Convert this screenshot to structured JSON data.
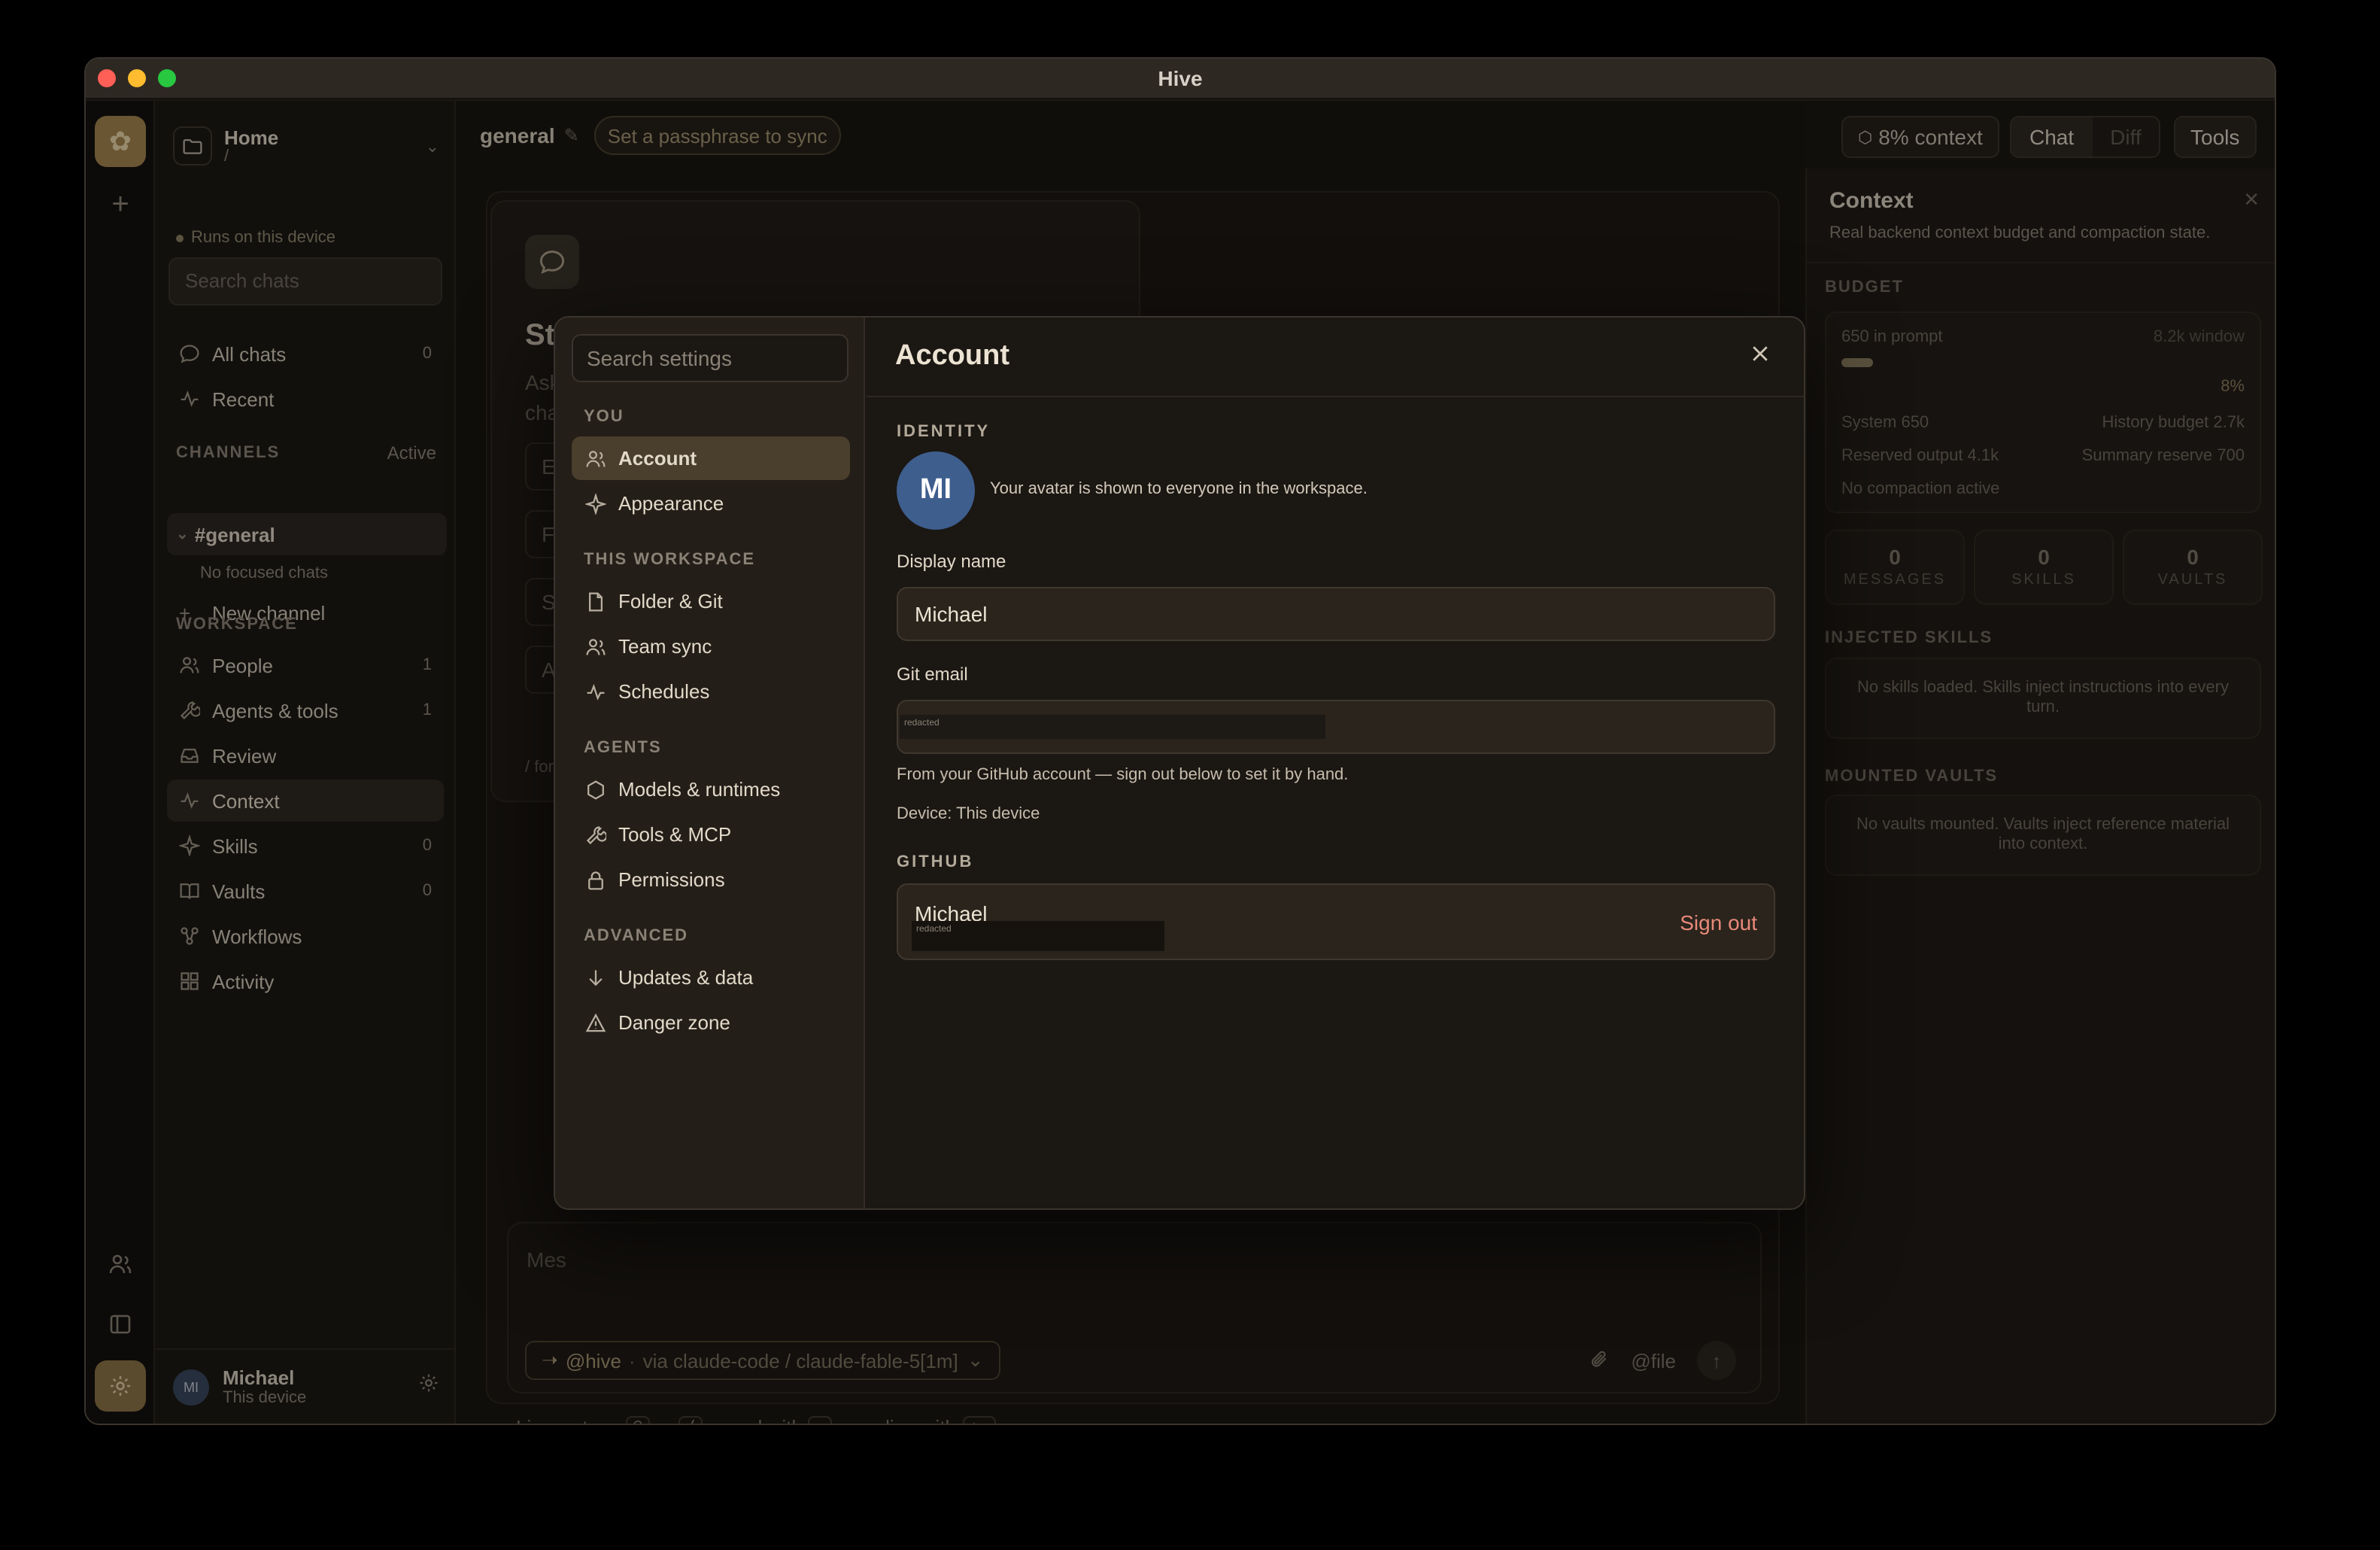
{
  "window": {
    "title": "Hive"
  },
  "sidebar": {
    "workspace_name": "Home",
    "workspace_path": "/",
    "runs_on": "Runs on this device",
    "search_placeholder": "Search chats",
    "all_chats": {
      "label": "All chats",
      "count": "0"
    },
    "recent": "Recent",
    "channels_label": "CHANNELS",
    "channels_status": "Active",
    "channel": "#general",
    "no_focused": "No focused chats",
    "new_channel": "New channel",
    "workspace_label": "WORKSPACE",
    "items": [
      {
        "label": "People",
        "count": "1",
        "icon": "people-icon"
      },
      {
        "label": "Agents & tools",
        "count": "1",
        "icon": "wrench-icon"
      },
      {
        "label": "Review",
        "count": "",
        "icon": "inbox-icon"
      },
      {
        "label": "Context",
        "count": "",
        "icon": "pulse-icon"
      },
      {
        "label": "Skills",
        "count": "0",
        "icon": "sparkle-icon"
      },
      {
        "label": "Vaults",
        "count": "0",
        "icon": "book-icon"
      },
      {
        "label": "Workflows",
        "count": "",
        "icon": "workflow-icon"
      },
      {
        "label": "Activity",
        "count": "",
        "icon": "grid-icon"
      }
    ],
    "user": {
      "initials": "MI",
      "name": "Michael",
      "sub": "This device"
    }
  },
  "main": {
    "channel_title": "general",
    "passphrase": "Set a passphrase to sync",
    "context_pill": "8% context",
    "tabs": [
      "Chat",
      "Diff"
    ],
    "tools": "Tools",
    "start": {
      "title": "Sta",
      "desc1": "Ask",
      "desc2": "cha",
      "opts": [
        "Ex",
        "Fi",
        "Su",
        "Ac"
      ],
      "footer": "/ for"
    },
    "composer_placeholder": "Mes",
    "hive_pill": {
      "agent": "@hive",
      "via": "via claude-code / claude-fable-5[1m]"
    },
    "file_btn": "@file",
    "hint": {
      "live": "Live — type",
      "k1": "@",
      "or": "or",
      "k2": "/",
      "send": ", send with",
      "k3": "↵",
      "newline": ", newline with",
      "k4": "⇧↵",
      "end": "."
    }
  },
  "context_panel": {
    "title": "Context",
    "subtitle": "Real backend context budget and compaction state.",
    "budget_label": "BUDGET",
    "in_prompt": "650 in prompt",
    "window": "8.2k window",
    "percent": "8%",
    "usage_fraction": 0.08,
    "system": "System 650",
    "history": "History budget 2.7k",
    "reserved": "Reserved output 4.1k",
    "summary": "Summary reserve 700",
    "compaction": "No compaction active",
    "stats": [
      {
        "value": "0",
        "label": "MESSAGES"
      },
      {
        "value": "0",
        "label": "SKILLS"
      },
      {
        "value": "0",
        "label": "VAULTS"
      }
    ],
    "injected_label": "INJECTED SKILLS",
    "injected_note": "No skills loaded. Skills inject instructions into every turn.",
    "vaults_label": "MOUNTED VAULTS",
    "vaults_note": "No vaults mounted. Vaults inject reference material into context."
  },
  "settings": {
    "search_placeholder": "Search settings",
    "sections": {
      "you": "YOU",
      "workspace": "THIS WORKSPACE",
      "agents": "AGENTS",
      "advanced": "ADVANCED"
    },
    "items": {
      "account": "Account",
      "appearance": "Appearance",
      "folder_git": "Folder & Git",
      "team_sync": "Team sync",
      "schedules": "Schedules",
      "models": "Models & runtimes",
      "tools_mcp": "Tools & MCP",
      "permissions": "Permissions",
      "updates": "Updates & data",
      "danger": "Danger zone"
    },
    "account": {
      "title": "Account",
      "identity_label": "IDENTITY",
      "avatar_initials": "MI",
      "avatar_note": "Your avatar is shown to everyone in the workspace.",
      "display_name_label": "Display name",
      "display_name": "Michael",
      "git_email_label": "Git email",
      "redacted": "redacted",
      "git_note": "From your GitHub account — sign out below to set it by hand.",
      "device": "Device: This device",
      "github_label": "GITHUB",
      "github_name": "Michael",
      "sign_out": "Sign out"
    }
  }
}
